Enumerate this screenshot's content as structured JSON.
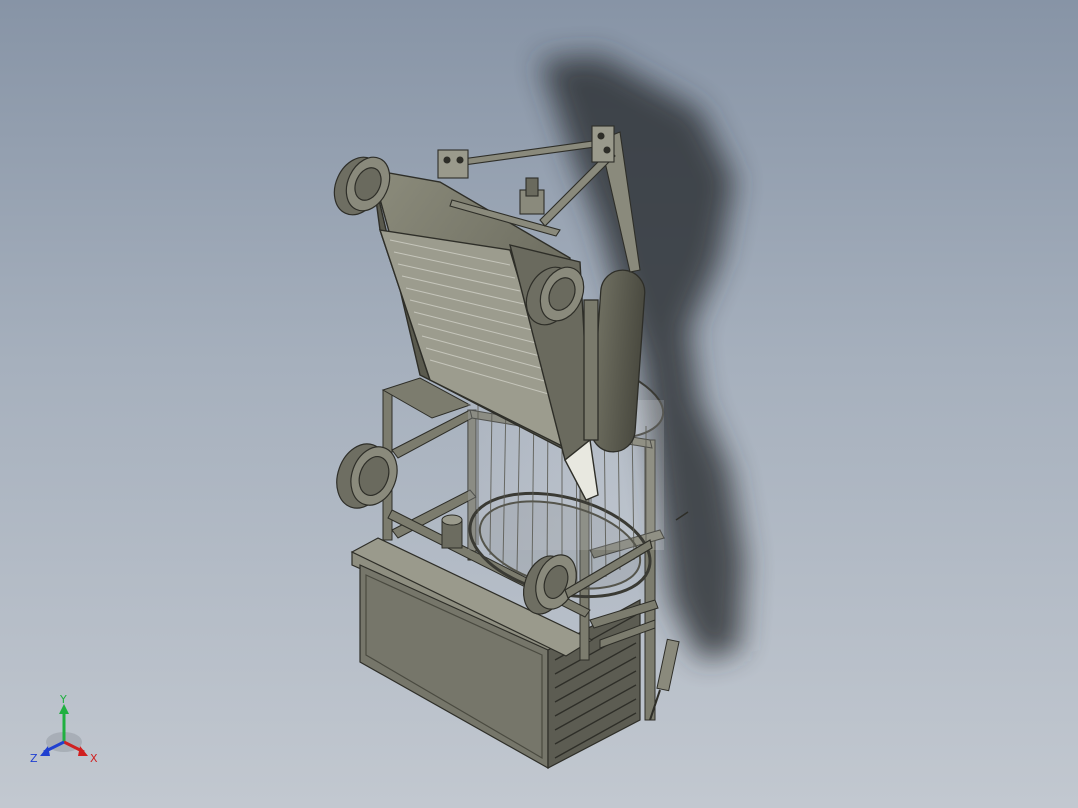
{
  "viewport": {
    "background_top": "#8794a6",
    "background_bottom": "#c2c8d0",
    "model_color": "#7a7a6a",
    "model_edge_color": "#2e2e28",
    "shadow_color": "#2a2d33"
  },
  "triad": {
    "x_label": "X",
    "y_label": "Y",
    "z_label": "Z",
    "x_color": "#d02020",
    "y_color": "#20b040",
    "z_color": "#2040d0"
  }
}
